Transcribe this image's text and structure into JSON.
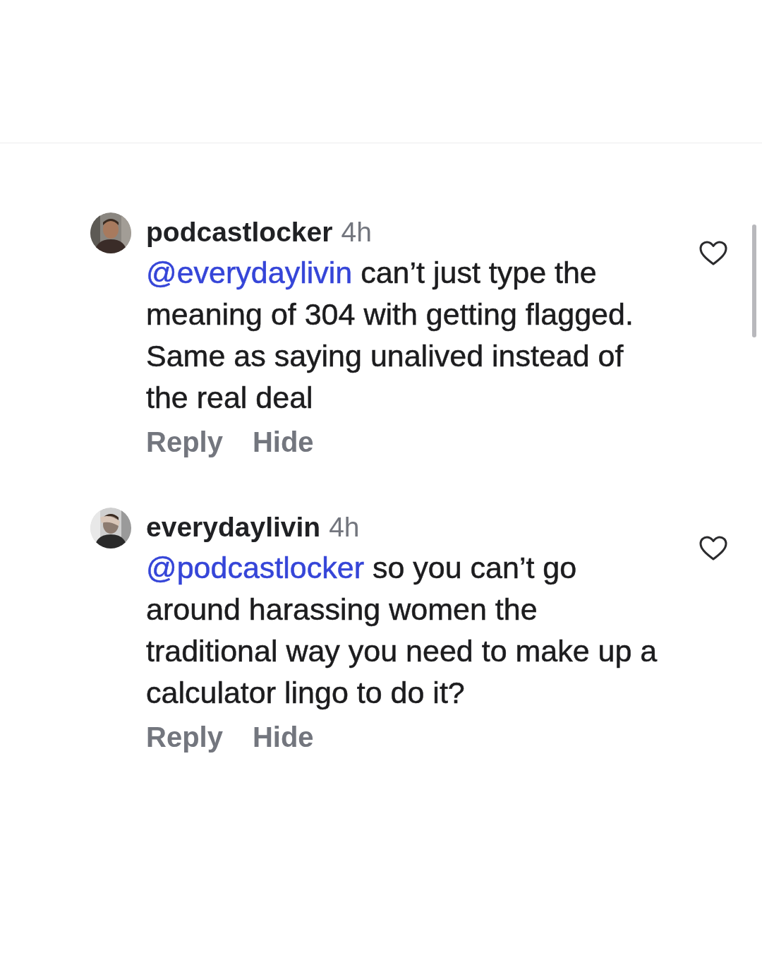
{
  "comments": [
    {
      "username": "podcastlocker",
      "time": "4h",
      "mention": "@everydaylivin",
      "text": " can’t just type the meaning of 304 with getting flagged.  Same as saying unalived instead of the real deal",
      "liked": false,
      "actions": [
        "Reply",
        "Hide"
      ]
    },
    {
      "username": "everydaylivin",
      "time": "4h",
      "mention": "@podcastlocker",
      "text": " so you can’t go around harassing women the traditional way you need to make up a calculator lingo to do it?",
      "liked": false,
      "actions": [
        "Reply",
        "Hide"
      ]
    }
  ]
}
